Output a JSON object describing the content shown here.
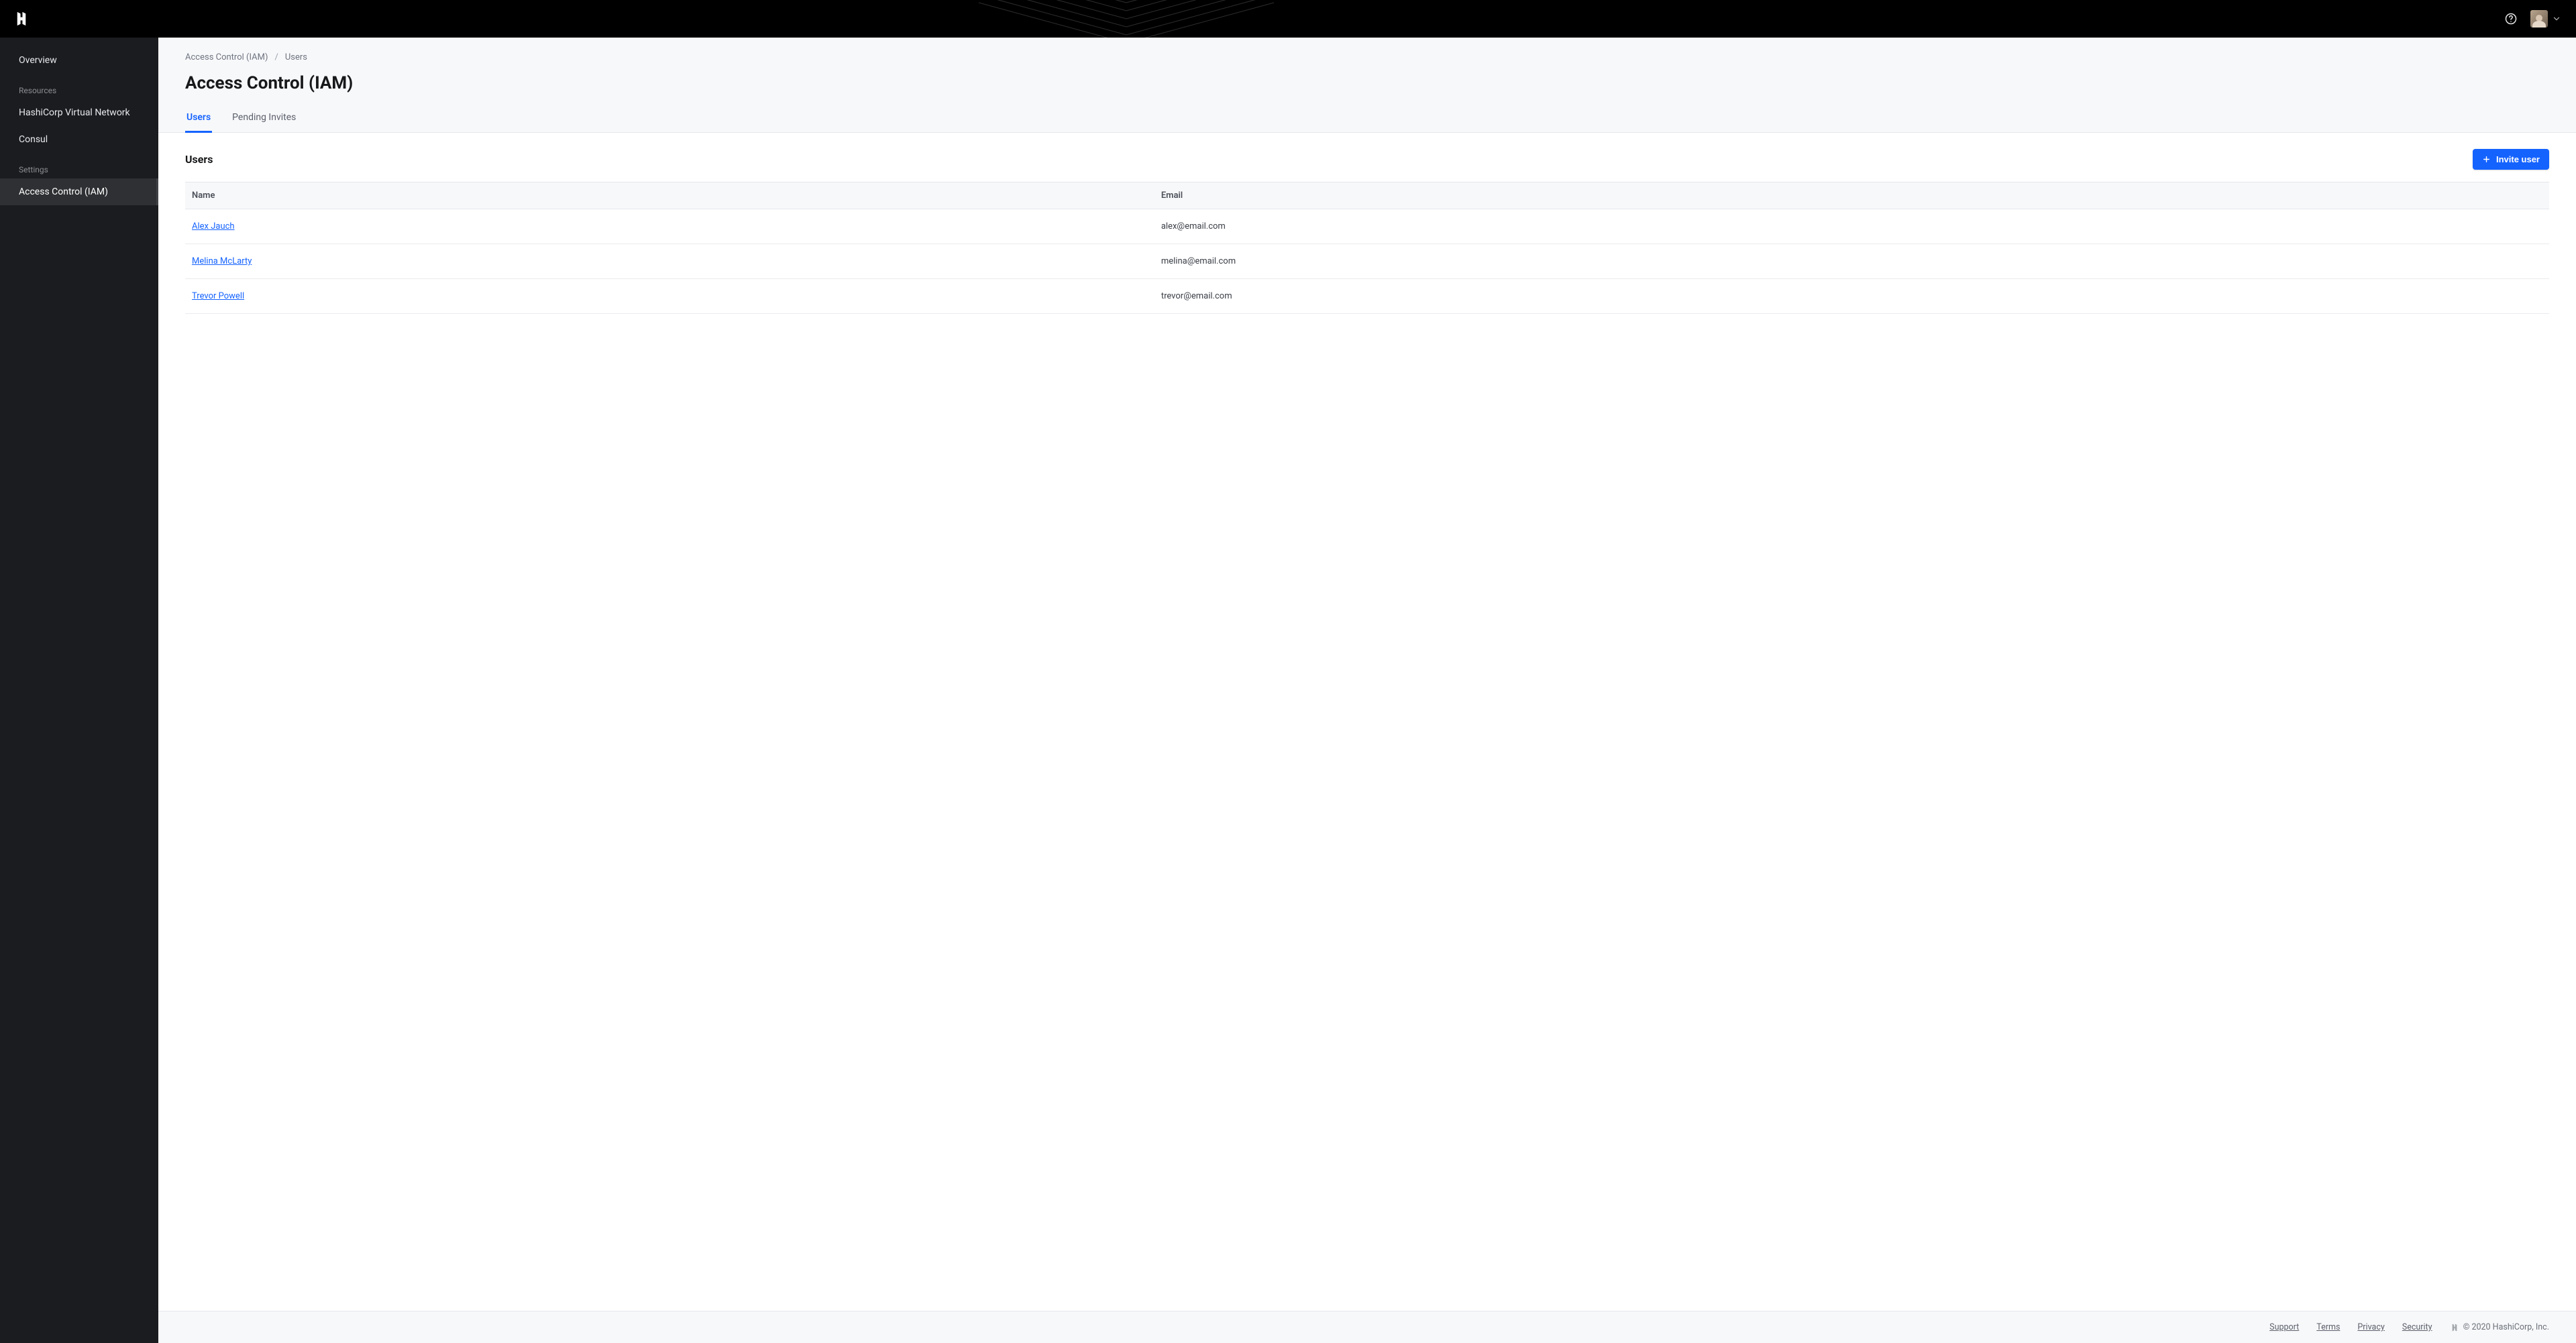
{
  "topbar": {
    "logo_name": "hashicorp-logo",
    "help_label": "Help"
  },
  "sidebar": {
    "items": [
      {
        "label": "Overview",
        "active": false
      }
    ],
    "resources_label": "Resources",
    "resources": [
      {
        "label": "HashiCorp Virtual Network"
      },
      {
        "label": "Consul"
      }
    ],
    "settings_label": "Settings",
    "settings": [
      {
        "label": "Access Control (IAM)",
        "active": true
      }
    ]
  },
  "breadcrumb": {
    "parent": "Access Control (IAM)",
    "current": "Users"
  },
  "page": {
    "title": "Access Control (IAM)"
  },
  "tabs": [
    {
      "label": "Users",
      "active": true
    },
    {
      "label": "Pending Invites",
      "active": false
    }
  ],
  "users_section": {
    "heading": "Users",
    "invite_button": "Invite user",
    "columns": {
      "name": "Name",
      "email": "Email"
    },
    "rows": [
      {
        "name": "Alex Jauch",
        "email": "alex@email.com"
      },
      {
        "name": "Melina McLarty",
        "email": "melina@email.com"
      },
      {
        "name": "Trevor Powell",
        "email": "trevor@email.com"
      }
    ]
  },
  "footer": {
    "links": [
      {
        "label": "Support"
      },
      {
        "label": "Terms"
      },
      {
        "label": "Privacy"
      },
      {
        "label": "Security"
      }
    ],
    "copyright": "© 2020 HashiCorp, Inc."
  }
}
